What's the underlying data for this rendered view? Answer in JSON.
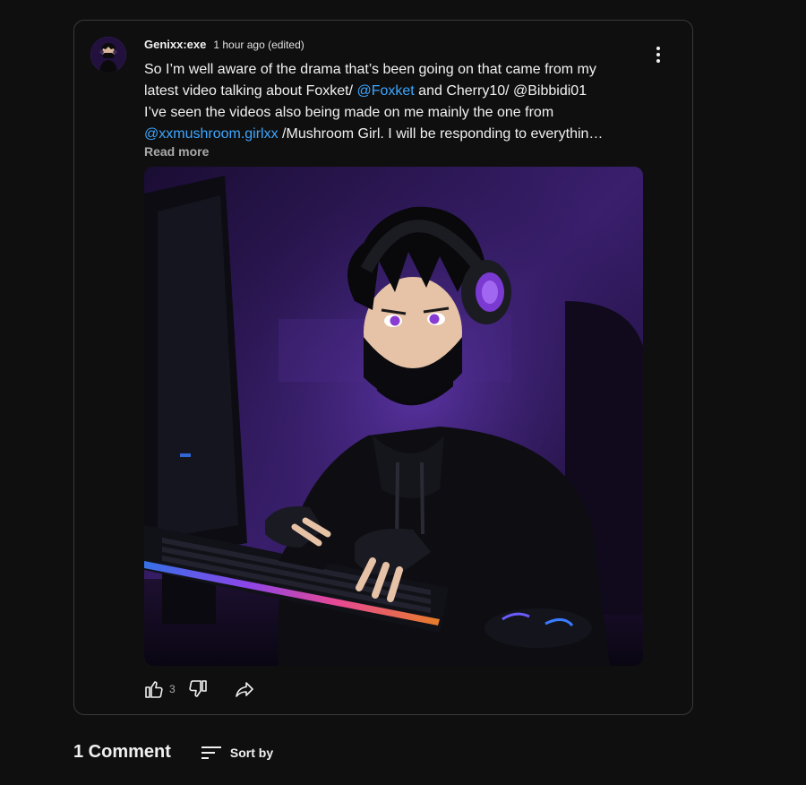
{
  "post": {
    "author": "Genixx:exe",
    "timestamp": "1 hour ago (edited)",
    "text": {
      "line1": "So I’m well aware of the drama that’s been going on that came from my",
      "line2_pre": "latest video talking about Foxket/ ",
      "line2_mention": "@Foxket",
      "line2_post": " and Cherry10/ @Bibbidi01",
      "line3": "I’ve seen the videos also being made on me mainly the one from",
      "line4_mention": "@xxmushroom.girlxx",
      "line4_post": " /Mushroom Girl. I will be responding to everythin…"
    },
    "read_more": "Read more",
    "like_count": "3"
  },
  "comments": {
    "count_label": "1 Comment",
    "sort_label": "Sort by"
  },
  "icons": {
    "menu": "more-vert-icon",
    "like": "thumbs-up-icon",
    "dislike": "thumbs-down-icon",
    "share": "share-arrow-icon",
    "sort": "sort-lines-icon"
  },
  "colors": {
    "background": "#0f0f0f",
    "mention": "#3ea6ff",
    "secondary_text": "#aaaaaa",
    "card_border": "#3a3a3a"
  }
}
